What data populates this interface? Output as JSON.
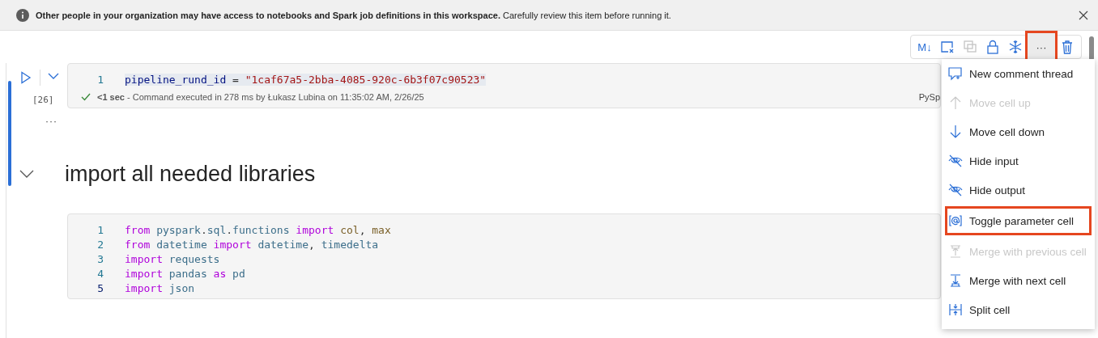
{
  "banner": {
    "text": "**Other people in your organization may have access to notebooks and Spark job definitions in this workspace.** Carefully review this item before running it."
  },
  "toolbar": [
    {
      "label": "M↓",
      "disabled": false,
      "highlighted": false
    },
    {
      "disabled": false,
      "highlighted": false
    },
    {
      "disabled": true,
      "highlighted": false
    },
    {
      "disabled": false,
      "highlighted": false
    },
    {
      "disabled": false,
      "highlighted": false
    },
    {
      "label": "···",
      "disabled": false,
      "highlighted": true
    },
    {
      "disabled": false,
      "highlighted": false
    }
  ],
  "cells": [
    {
      "kind": "code",
      "active": true,
      "execution_count": "[26]",
      "more": "···",
      "status": "**<1 sec** - Command executed in 278 ms by Łukasz Lubina on 11:35:02 AM, 2/26/25",
      "language": "PySp",
      "lines": [
        {
          "number": "1",
          "current": false,
          "highlighted": true,
          "tokens": [
            {
              "kind": "var",
              "text": "pipeline_rund_id"
            },
            {
              "kind": "op",
              "text": " = "
            },
            {
              "kind": "str",
              "text": "\"1caf67a5-2bba-4085-920c-6b3f07c90523\""
            }
          ]
        }
      ]
    },
    {
      "kind": "markdown",
      "active": false,
      "heading": "import all needed libraries"
    },
    {
      "kind": "code",
      "active": false,
      "lines": [
        {
          "number": "1",
          "current": false,
          "highlighted": false,
          "tokens": [
            {
              "kind": "kw",
              "text": "from"
            },
            {
              "kind": "name",
              "text": " pyspark"
            },
            {
              "kind": "op",
              "text": "."
            },
            {
              "kind": "name",
              "text": "sql"
            },
            {
              "kind": "op",
              "text": "."
            },
            {
              "kind": "name",
              "text": "functions "
            },
            {
              "kind": "kw",
              "text": "import"
            },
            {
              "kind": "fn",
              "text": " col"
            },
            {
              "kind": "op",
              "text": ", "
            },
            {
              "kind": "fn",
              "text": "max"
            }
          ]
        },
        {
          "number": "2",
          "current": false,
          "highlighted": false,
          "tokens": [
            {
              "kind": "kw",
              "text": "from"
            },
            {
              "kind": "name",
              "text": " datetime "
            },
            {
              "kind": "kw",
              "text": "import"
            },
            {
              "kind": "name",
              "text": " datetime"
            },
            {
              "kind": "op",
              "text": ", "
            },
            {
              "kind": "name",
              "text": "timedelta"
            }
          ]
        },
        {
          "number": "3",
          "current": false,
          "highlighted": false,
          "tokens": [
            {
              "kind": "kw",
              "text": "import"
            },
            {
              "kind": "name",
              "text": " requests"
            }
          ]
        },
        {
          "number": "4",
          "current": false,
          "highlighted": false,
          "tokens": [
            {
              "kind": "kw",
              "text": "import"
            },
            {
              "kind": "name",
              "text": " pandas "
            },
            {
              "kind": "kw",
              "text": "as"
            },
            {
              "kind": "name",
              "text": " pd"
            }
          ]
        },
        {
          "number": "5",
          "current": true,
          "highlighted": false,
          "tokens": [
            {
              "kind": "kw",
              "text": "import"
            },
            {
              "kind": "name",
              "text": " json"
            }
          ]
        }
      ]
    }
  ],
  "menu": {
    "items": [
      {
        "label": "New comment thread",
        "disabled": false,
        "highlighted": false
      },
      {
        "label": "Move cell up",
        "disabled": true,
        "highlighted": false
      },
      {
        "label": "Move cell down",
        "disabled": false,
        "highlighted": false
      },
      {
        "label": "Hide input",
        "disabled": false,
        "highlighted": false
      },
      {
        "label": "Hide output",
        "disabled": false,
        "highlighted": false
      },
      {
        "label": "Toggle parameter cell",
        "disabled": false,
        "highlighted": true
      },
      {
        "label": "Merge with previous cell",
        "disabled": true,
        "highlighted": false
      },
      {
        "label": "Merge with next cell",
        "disabled": false,
        "highlighted": false
      },
      {
        "label": "Split cell",
        "disabled": false,
        "highlighted": false
      }
    ]
  }
}
